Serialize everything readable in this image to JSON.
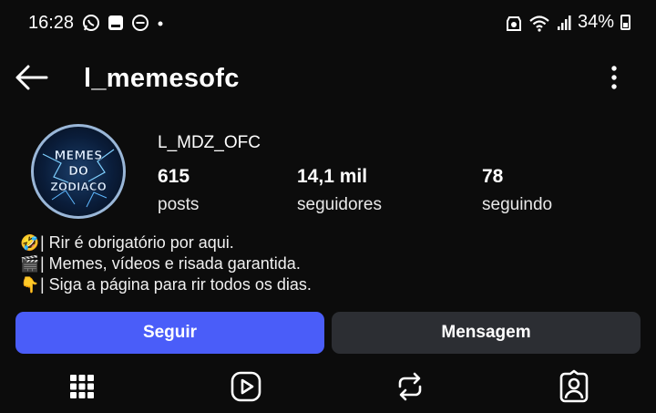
{
  "status_bar": {
    "time": "16:28",
    "battery": "34%"
  },
  "header": {
    "username": "l_memesofc"
  },
  "profile": {
    "display_name": "L_MDZ_OFC",
    "avatar_text_top": "MEMES",
    "avatar_text_mid": "DO",
    "avatar_text_bottom": "ZODIACO",
    "stats": [
      {
        "value": "615",
        "label": "posts"
      },
      {
        "value": "14,1 mil",
        "label": "seguidores"
      },
      {
        "value": "78",
        "label": "seguindo"
      }
    ],
    "bio": [
      {
        "icon": "🤣",
        "text": "| Rir é obrigatório por aqui."
      },
      {
        "icon": "🎬",
        "text": "| Memes, vídeos e risada garantida."
      },
      {
        "icon": "👇",
        "text": "| Siga a página para rir todos os dias."
      }
    ]
  },
  "actions": {
    "follow_label": "Seguir",
    "message_label": "Mensagem"
  },
  "tabs": [
    "grid-icon",
    "reels-icon",
    "reposts-icon",
    "tagged-icon"
  ],
  "colors": {
    "follow_button": "#4a5df9",
    "message_button": "#2c2e33",
    "background": "#0c0c0c"
  }
}
